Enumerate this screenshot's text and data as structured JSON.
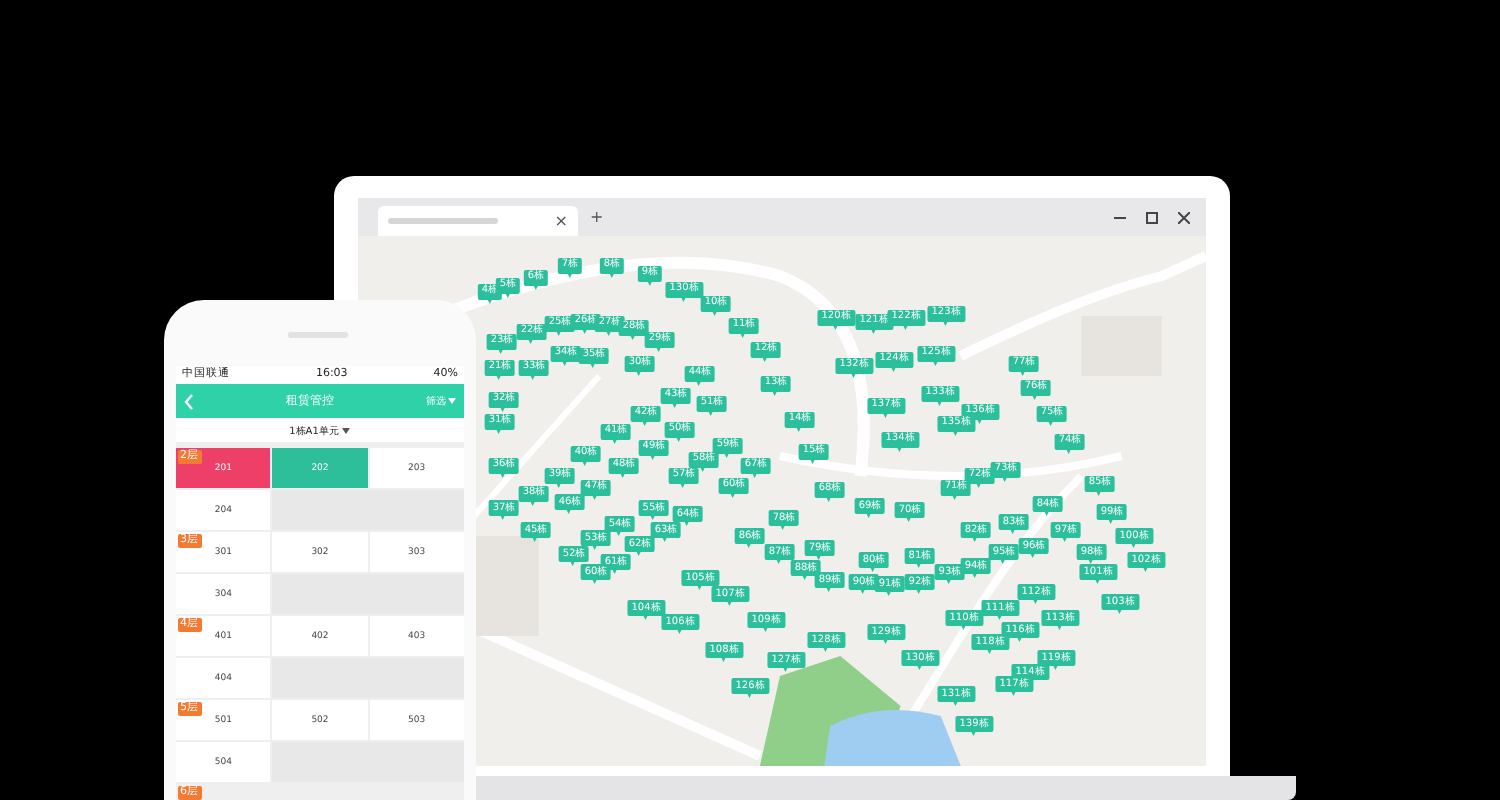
{
  "browser": {
    "new_tab": "+",
    "close_tab": "×"
  },
  "map": {
    "markers": [
      "4栋",
      "5栋",
      "6栋",
      "7栋",
      "8栋",
      "9栋",
      "130栋",
      "10栋",
      "11栋",
      "12栋",
      "13栋",
      "14栋",
      "15栋",
      "23栋",
      "21栋",
      "22栋",
      "25栋",
      "26栋",
      "27栋",
      "28栋",
      "29栋",
      "33栋",
      "34栋",
      "35栋",
      "30栋",
      "44栋",
      "32栋",
      "43栋",
      "51栋",
      "31栋",
      "36栋",
      "42栋",
      "41栋",
      "50栋",
      "49栋",
      "40栋",
      "48栋",
      "39栋",
      "59栋",
      "58栋",
      "57栋",
      "60栋",
      "67栋",
      "47栋",
      "38栋",
      "46栋",
      "37栋",
      "55栋",
      "64栋",
      "45栋",
      "54栋",
      "63栋",
      "53栋",
      "62栋",
      "52栋",
      "61栋",
      "60栋",
      "78栋",
      "86栋",
      "87栋",
      "79栋",
      "88栋",
      "105栋",
      "107栋",
      "104栋",
      "106栋",
      "109栋",
      "108栋",
      "127栋",
      "128栋",
      "126栋",
      "120栋",
      "121栋",
      "122栋",
      "123栋",
      "132栋",
      "124栋",
      "125栋",
      "77栋",
      "76栋",
      "133栋",
      "137栋",
      "136栋",
      "135栋",
      "75栋",
      "134栋",
      "74栋",
      "72栋",
      "73栋",
      "71栋",
      "85栋",
      "68栋",
      "69栋",
      "70栋",
      "84栋",
      "99栋",
      "82栋",
      "83栋",
      "97栋",
      "100栋",
      "80栋",
      "81栋",
      "95栋",
      "96栋",
      "98栋",
      "101栋",
      "102栋",
      "89栋",
      "90栋",
      "91栋",
      "92栋",
      "93栋",
      "94栋",
      "112栋",
      "111栋",
      "110栋",
      "113栋",
      "116栋",
      "103栋",
      "129栋",
      "118栋",
      "130栋",
      "119栋",
      "114栋",
      "117栋",
      "131栋",
      "139栋"
    ]
  },
  "phone": {
    "status_bar": {
      "carrier": "中国联通",
      "time": "16:03",
      "battery": "40%"
    },
    "header": {
      "title": "租赁管控",
      "action": "筛选"
    },
    "building_selector": "1栋A1单元",
    "floors": [
      {
        "label": "2层",
        "rooms": [
          {
            "number": "201",
            "rented": true,
            "selected": false
          },
          {
            "number": "202",
            "rented": false,
            "selected": true
          },
          {
            "number": "203",
            "rented": false,
            "selected": false
          },
          {
            "number": "204",
            "rented": false,
            "selected": false
          }
        ]
      },
      {
        "label": "3层",
        "rooms": [
          {
            "number": "301",
            "rented": false,
            "selected": false
          },
          {
            "number": "302",
            "rented": false,
            "selected": false
          },
          {
            "number": "303",
            "rented": false,
            "selected": false
          },
          {
            "number": "304",
            "rented": false,
            "selected": false
          }
        ]
      },
      {
        "label": "4层",
        "rooms": [
          {
            "number": "401",
            "rented": false,
            "selected": false
          },
          {
            "number": "402",
            "rented": false,
            "selected": false
          },
          {
            "number": "403",
            "rented": false,
            "selected": false
          },
          {
            "number": "404",
            "rented": false,
            "selected": false
          }
        ]
      },
      {
        "label": "5层",
        "rooms": [
          {
            "number": "501",
            "rented": false,
            "selected": false
          },
          {
            "number": "502",
            "rented": false,
            "selected": false
          },
          {
            "number": "503",
            "rented": false,
            "selected": false
          },
          {
            "number": "504",
            "rented": false,
            "selected": false
          }
        ]
      },
      {
        "label": "6层"
      }
    ]
  }
}
